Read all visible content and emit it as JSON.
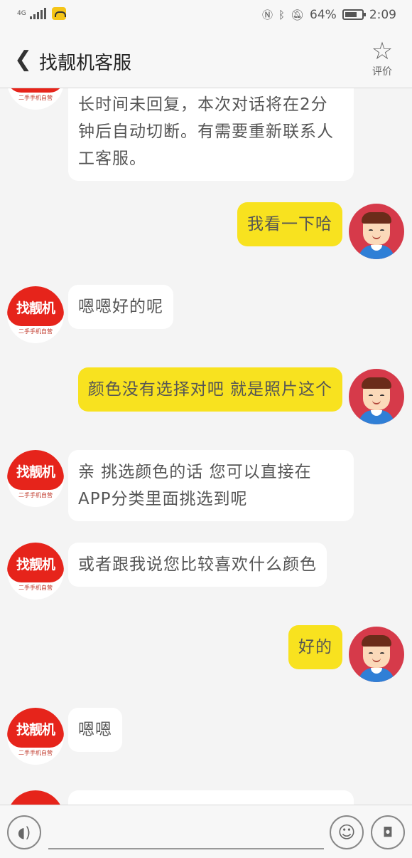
{
  "status_bar": {
    "network": "4G",
    "battery": "64%",
    "time": "2:09"
  },
  "header": {
    "title": "找靓机客服",
    "rate_label": "评价"
  },
  "shop_avatar": {
    "logo_text": "找靓机",
    "subtitle": "二手手机自营"
  },
  "messages": [
    {
      "from": "shop",
      "text": "长时间未回复，本次对话将在2分钟后自动切断。有需要重新联系人工客服。"
    },
    {
      "from": "user",
      "text": "我看一下哈"
    },
    {
      "from": "shop",
      "text": "嗯嗯好的呢"
    },
    {
      "from": "user",
      "text": "颜色没有选择对吧 就是照片这个"
    },
    {
      "from": "shop",
      "text": "亲 挑选颜色的话 您可以直接在APP分类里面挑选到呢"
    },
    {
      "from": "shop",
      "text": "或者跟我说您比较喜欢什么颜色"
    },
    {
      "from": "user",
      "text": "好的"
    },
    {
      "from": "shop",
      "text": "嗯嗯"
    }
  ],
  "colors": {
    "user_bubble": "#f8e21f",
    "shop_bubble": "#ffffff",
    "brand_red": "#e6241b"
  }
}
